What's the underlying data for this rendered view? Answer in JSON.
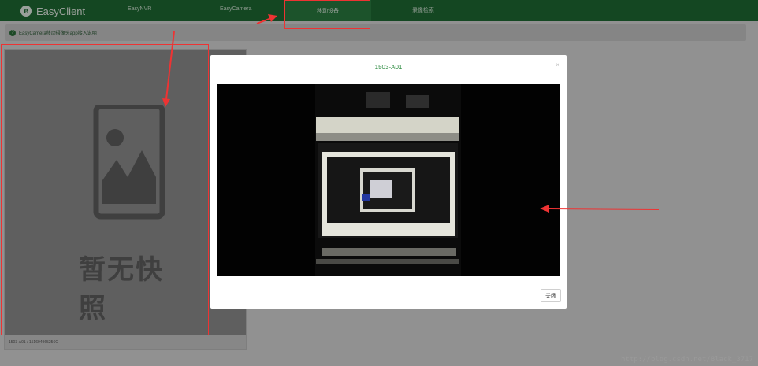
{
  "nav": {
    "brand": "EasyClient",
    "brand_icon": "e-logo-icon",
    "items": [
      {
        "label": "EasyNVR"
      },
      {
        "label": "EasyCamera"
      },
      {
        "label": "移动设备"
      },
      {
        "label": "录像检索"
      }
    ],
    "active_index": 2
  },
  "info": {
    "icon": "question-circle-icon",
    "text": "EasyCamera移动摄像头app接入说明"
  },
  "card": {
    "placeholder_text": "暂无快照",
    "footer": "1503-A01 / 151694965256C"
  },
  "modal": {
    "title": "1503-A01",
    "close_x": "×",
    "close_button": "关闭"
  },
  "watermark": "http://blog.csdn.net/Black_3717",
  "colors": {
    "nav_bg": "#1f6b33",
    "accent_green": "#2a8a3e",
    "annotation_red": "#ee3333"
  }
}
